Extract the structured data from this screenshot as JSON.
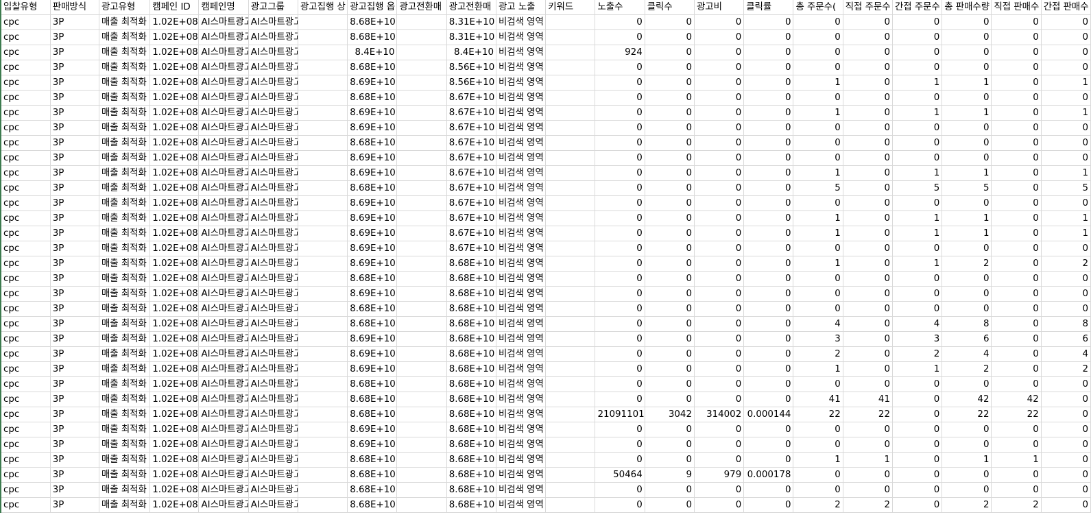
{
  "columns": [
    {
      "label": "입찰유형",
      "type": "txt"
    },
    {
      "label": "판매방식",
      "type": "txt"
    },
    {
      "label": "광고유형",
      "type": "txt"
    },
    {
      "label": "캠페인 ID",
      "type": "txt"
    },
    {
      "label": "캠페인명",
      "type": "txt"
    },
    {
      "label": "광고그룹",
      "type": "txt"
    },
    {
      "label": "광고집행 상",
      "type": "txt"
    },
    {
      "label": "광고집행 옵",
      "type": "txt"
    },
    {
      "label": "광고전환매",
      "type": "txt"
    },
    {
      "label": "광고전환매",
      "type": "txt"
    },
    {
      "label": "광고 노출",
      "type": "txt"
    },
    {
      "label": "키워드",
      "type": "txt"
    },
    {
      "label": "노출수",
      "type": "txt"
    },
    {
      "label": "클릭수",
      "type": "txt"
    },
    {
      "label": "광고비",
      "type": "txt"
    },
    {
      "label": "클릭률",
      "type": "txt"
    },
    {
      "label": "총 주문수(",
      "type": "txt"
    },
    {
      "label": "직접 주문수",
      "type": "txt"
    },
    {
      "label": "간접 주문수",
      "type": "txt"
    },
    {
      "label": "총 판매수량",
      "type": "txt"
    },
    {
      "label": "직접 판매수",
      "type": "txt"
    },
    {
      "label": "간접 판매수",
      "type": "txt"
    }
  ],
  "rows": [
    [
      "cpc",
      "3P",
      "매출 최적화",
      "1.02E+08",
      "AI스마트광고",
      "AI스마트광고",
      "",
      "8.68E+10",
      "",
      "8.31E+10",
      "비검색 영역",
      "",
      "0",
      "0",
      "0",
      "0",
      "0",
      "0",
      "0",
      "0",
      "0",
      "0"
    ],
    [
      "cpc",
      "3P",
      "매출 최적화",
      "1.02E+08",
      "AI스마트광고",
      "AI스마트광고",
      "",
      "8.68E+10",
      "",
      "8.31E+10",
      "비검색 영역",
      "",
      "0",
      "0",
      "0",
      "0",
      "0",
      "0",
      "0",
      "0",
      "0",
      "0"
    ],
    [
      "cpc",
      "3P",
      "매출 최적화",
      "1.02E+08",
      "AI스마트광고",
      "AI스마트광고",
      "",
      "8.4E+10",
      "",
      "8.4E+10",
      "비검색 영역",
      "",
      "924",
      "0",
      "0",
      "0",
      "0",
      "0",
      "0",
      "0",
      "0",
      "0"
    ],
    [
      "cpc",
      "3P",
      "매출 최적화",
      "1.02E+08",
      "AI스마트광고",
      "AI스마트광고",
      "",
      "8.68E+10",
      "",
      "8.56E+10",
      "비검색 영역",
      "",
      "0",
      "0",
      "0",
      "0",
      "0",
      "0",
      "0",
      "0",
      "0",
      "0"
    ],
    [
      "cpc",
      "3P",
      "매출 최적화",
      "1.02E+08",
      "AI스마트광고",
      "AI스마트광고",
      "",
      "8.69E+10",
      "",
      "8.56E+10",
      "비검색 영역",
      "",
      "0",
      "0",
      "0",
      "0",
      "1",
      "0",
      "1",
      "1",
      "0",
      "1"
    ],
    [
      "cpc",
      "3P",
      "매출 최적화",
      "1.02E+08",
      "AI스마트광고",
      "AI스마트광고",
      "",
      "8.68E+10",
      "",
      "8.67E+10",
      "비검색 영역",
      "",
      "0",
      "0",
      "0",
      "0",
      "0",
      "0",
      "0",
      "0",
      "0",
      "0"
    ],
    [
      "cpc",
      "3P",
      "매출 최적화",
      "1.02E+08",
      "AI스마트광고",
      "AI스마트광고",
      "",
      "8.69E+10",
      "",
      "8.67E+10",
      "비검색 영역",
      "",
      "0",
      "0",
      "0",
      "0",
      "1",
      "0",
      "1",
      "1",
      "0",
      "1"
    ],
    [
      "cpc",
      "3P",
      "매출 최적화",
      "1.02E+08",
      "AI스마트광고",
      "AI스마트광고",
      "",
      "8.69E+10",
      "",
      "8.67E+10",
      "비검색 영역",
      "",
      "0",
      "0",
      "0",
      "0",
      "0",
      "0",
      "0",
      "0",
      "0",
      "0"
    ],
    [
      "cpc",
      "3P",
      "매출 최적화",
      "1.02E+08",
      "AI스마트광고",
      "AI스마트광고",
      "",
      "8.68E+10",
      "",
      "8.67E+10",
      "비검색 영역",
      "",
      "0",
      "0",
      "0",
      "0",
      "0",
      "0",
      "0",
      "0",
      "0",
      "0"
    ],
    [
      "cpc",
      "3P",
      "매출 최적화",
      "1.02E+08",
      "AI스마트광고",
      "AI스마트광고",
      "",
      "8.69E+10",
      "",
      "8.67E+10",
      "비검색 영역",
      "",
      "0",
      "0",
      "0",
      "0",
      "0",
      "0",
      "0",
      "0",
      "0",
      "0"
    ],
    [
      "cpc",
      "3P",
      "매출 최적화",
      "1.02E+08",
      "AI스마트광고",
      "AI스마트광고",
      "",
      "8.69E+10",
      "",
      "8.67E+10",
      "비검색 영역",
      "",
      "0",
      "0",
      "0",
      "0",
      "1",
      "0",
      "1",
      "1",
      "0",
      "1"
    ],
    [
      "cpc",
      "3P",
      "매출 최적화",
      "1.02E+08",
      "AI스마트광고",
      "AI스마트광고",
      "",
      "8.68E+10",
      "",
      "8.67E+10",
      "비검색 영역",
      "",
      "0",
      "0",
      "0",
      "0",
      "5",
      "0",
      "5",
      "5",
      "0",
      "5"
    ],
    [
      "cpc",
      "3P",
      "매출 최적화",
      "1.02E+08",
      "AI스마트광고",
      "AI스마트광고",
      "",
      "8.69E+10",
      "",
      "8.67E+10",
      "비검색 영역",
      "",
      "0",
      "0",
      "0",
      "0",
      "0",
      "0",
      "0",
      "0",
      "0",
      "0"
    ],
    [
      "cpc",
      "3P",
      "매출 최적화",
      "1.02E+08",
      "AI스마트광고",
      "AI스마트광고",
      "",
      "8.69E+10",
      "",
      "8.67E+10",
      "비검색 영역",
      "",
      "0",
      "0",
      "0",
      "0",
      "1",
      "0",
      "1",
      "1",
      "0",
      "1"
    ],
    [
      "cpc",
      "3P",
      "매출 최적화",
      "1.02E+08",
      "AI스마트광고",
      "AI스마트광고",
      "",
      "8.69E+10",
      "",
      "8.67E+10",
      "비검색 영역",
      "",
      "0",
      "0",
      "0",
      "0",
      "1",
      "0",
      "1",
      "1",
      "0",
      "1"
    ],
    [
      "cpc",
      "3P",
      "매출 최적화",
      "1.02E+08",
      "AI스마트광고",
      "AI스마트광고",
      "",
      "8.69E+10",
      "",
      "8.67E+10",
      "비검색 영역",
      "",
      "0",
      "0",
      "0",
      "0",
      "0",
      "0",
      "0",
      "0",
      "0",
      "0"
    ],
    [
      "cpc",
      "3P",
      "매출 최적화",
      "1.02E+08",
      "AI스마트광고",
      "AI스마트광고",
      "",
      "8.69E+10",
      "",
      "8.68E+10",
      "비검색 영역",
      "",
      "0",
      "0",
      "0",
      "0",
      "1",
      "0",
      "1",
      "2",
      "0",
      "2"
    ],
    [
      "cpc",
      "3P",
      "매출 최적화",
      "1.02E+08",
      "AI스마트광고",
      "AI스마트광고",
      "",
      "8.68E+10",
      "",
      "8.68E+10",
      "비검색 영역",
      "",
      "0",
      "0",
      "0",
      "0",
      "0",
      "0",
      "0",
      "0",
      "0",
      "0"
    ],
    [
      "cpc",
      "3P",
      "매출 최적화",
      "1.02E+08",
      "AI스마트광고",
      "AI스마트광고",
      "",
      "8.69E+10",
      "",
      "8.68E+10",
      "비검색 영역",
      "",
      "0",
      "0",
      "0",
      "0",
      "0",
      "0",
      "0",
      "0",
      "0",
      "0"
    ],
    [
      "cpc",
      "3P",
      "매출 최적화",
      "1.02E+08",
      "AI스마트광고",
      "AI스마트광고",
      "",
      "8.68E+10",
      "",
      "8.68E+10",
      "비검색 영역",
      "",
      "0",
      "0",
      "0",
      "0",
      "0",
      "0",
      "0",
      "0",
      "0",
      "0"
    ],
    [
      "cpc",
      "3P",
      "매출 최적화",
      "1.02E+08",
      "AI스마트광고",
      "AI스마트광고",
      "",
      "8.68E+10",
      "",
      "8.68E+10",
      "비검색 영역",
      "",
      "0",
      "0",
      "0",
      "0",
      "4",
      "0",
      "4",
      "8",
      "0",
      "8"
    ],
    [
      "cpc",
      "3P",
      "매출 최적화",
      "1.02E+08",
      "AI스마트광고",
      "AI스마트광고",
      "",
      "8.69E+10",
      "",
      "8.68E+10",
      "비검색 영역",
      "",
      "0",
      "0",
      "0",
      "0",
      "3",
      "0",
      "3",
      "6",
      "0",
      "6"
    ],
    [
      "cpc",
      "3P",
      "매출 최적화",
      "1.02E+08",
      "AI스마트광고",
      "AI스마트광고",
      "",
      "8.69E+10",
      "",
      "8.68E+10",
      "비검색 영역",
      "",
      "0",
      "0",
      "0",
      "0",
      "2",
      "0",
      "2",
      "4",
      "0",
      "4"
    ],
    [
      "cpc",
      "3P",
      "매출 최적화",
      "1.02E+08",
      "AI스마트광고",
      "AI스마트광고",
      "",
      "8.69E+10",
      "",
      "8.68E+10",
      "비검색 영역",
      "",
      "0",
      "0",
      "0",
      "0",
      "1",
      "0",
      "1",
      "2",
      "0",
      "2"
    ],
    [
      "cpc",
      "3P",
      "매출 최적화",
      "1.02E+08",
      "AI스마트광고",
      "AI스마트광고",
      "",
      "8.68E+10",
      "",
      "8.68E+10",
      "비검색 영역",
      "",
      "0",
      "0",
      "0",
      "0",
      "0",
      "0",
      "0",
      "0",
      "0",
      "0"
    ],
    [
      "cpc",
      "3P",
      "매출 최적화",
      "1.02E+08",
      "AI스마트광고",
      "AI스마트광고",
      "",
      "8.68E+10",
      "",
      "8.68E+10",
      "비검색 영역",
      "",
      "0",
      "0",
      "0",
      "0",
      "41",
      "41",
      "0",
      "42",
      "42",
      "0"
    ],
    [
      "cpc",
      "3P",
      "매출 최적화",
      "1.02E+08",
      "AI스마트광고",
      "AI스마트광고",
      "",
      "8.68E+10",
      "",
      "8.68E+10",
      "비검색 영역",
      "",
      "21091101",
      "3042",
      "314002",
      "0.000144",
      "22",
      "22",
      "0",
      "22",
      "22",
      "0"
    ],
    [
      "cpc",
      "3P",
      "매출 최적화",
      "1.02E+08",
      "AI스마트광고",
      "AI스마트광고",
      "",
      "8.69E+10",
      "",
      "8.68E+10",
      "비검색 영역",
      "",
      "0",
      "0",
      "0",
      "0",
      "0",
      "0",
      "0",
      "0",
      "0",
      "0"
    ],
    [
      "cpc",
      "3P",
      "매출 최적화",
      "1.02E+08",
      "AI스마트광고",
      "AI스마트광고",
      "",
      "8.69E+10",
      "",
      "8.68E+10",
      "비검색 영역",
      "",
      "0",
      "0",
      "0",
      "0",
      "0",
      "0",
      "0",
      "0",
      "0",
      "0"
    ],
    [
      "cpc",
      "3P",
      "매출 최적화",
      "1.02E+08",
      "AI스마트광고",
      "AI스마트광고",
      "",
      "8.68E+10",
      "",
      "8.68E+10",
      "비검색 영역",
      "",
      "0",
      "0",
      "0",
      "0",
      "1",
      "1",
      "0",
      "1",
      "1",
      "0"
    ],
    [
      "cpc",
      "3P",
      "매출 최적화",
      "1.02E+08",
      "AI스마트광고",
      "AI스마트광고",
      "",
      "8.68E+10",
      "",
      "8.68E+10",
      "비검색 영역",
      "",
      "50464",
      "9",
      "979",
      "0.000178",
      "0",
      "0",
      "0",
      "0",
      "0",
      "0"
    ],
    [
      "cpc",
      "3P",
      "매출 최적화",
      "1.02E+08",
      "AI스마트광고",
      "AI스마트광고",
      "",
      "8.68E+10",
      "",
      "8.68E+10",
      "비검색 영역",
      "",
      "0",
      "0",
      "0",
      "0",
      "0",
      "0",
      "0",
      "0",
      "0",
      "0"
    ],
    [
      "cpc",
      "3P",
      "매출 최적화",
      "1.02E+08",
      "AI스마트광고",
      "AI스마트광고",
      "",
      "8.68E+10",
      "",
      "8.68E+10",
      "비검색 영역",
      "",
      "0",
      "0",
      "0",
      "0",
      "2",
      "2",
      "0",
      "2",
      "2",
      "0"
    ]
  ],
  "numeric_columns": [
    3,
    7,
    9,
    12,
    13,
    14,
    15,
    16,
    17,
    18,
    19,
    20,
    21
  ]
}
